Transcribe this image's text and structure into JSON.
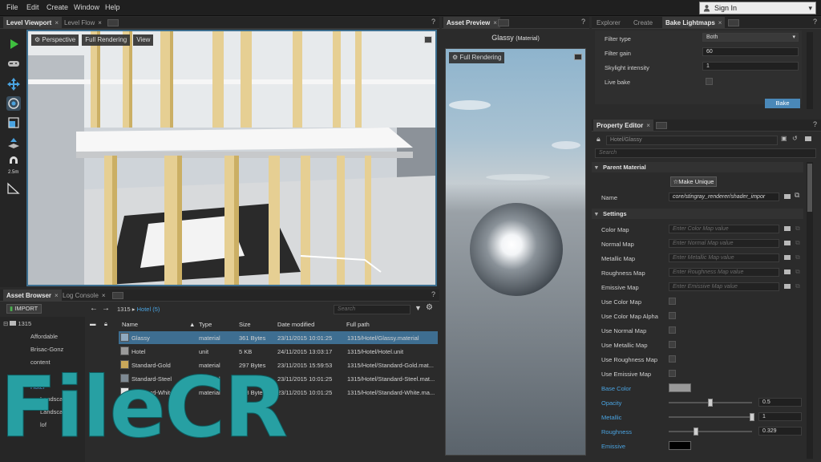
{
  "menu": [
    "File",
    "Edit",
    "Create",
    "Window",
    "Help"
  ],
  "signin": {
    "label": "Sign In"
  },
  "viewport_tabs": [
    "Level Viewport",
    "Level Flow"
  ],
  "viewport_toolbar": {
    "perspective": "Perspective",
    "rendering": "Full Rendering",
    "view": "View"
  },
  "tools": {
    "scale_label": "2.5m"
  },
  "asset_browser": {
    "tabs": [
      "Asset Browser",
      "Log Console"
    ],
    "import_label": "IMPORT",
    "breadcrumb_root": "1315",
    "breadcrumb_current": "Hotel (5)",
    "search_placeholder": "Search",
    "tree": [
      {
        "label": "1315"
      },
      {
        "label": "Affordable"
      },
      {
        "label": "Brisac-Gonz"
      },
      {
        "label": "content"
      },
      {
        "label": "Hotel"
      },
      {
        "label": "Landscape"
      },
      {
        "label": "Landscap"
      },
      {
        "label": "lof"
      }
    ],
    "columns": {
      "name": "Name",
      "type": "Type",
      "size": "Size",
      "date": "Date modified",
      "path": "Full path"
    },
    "rows": [
      {
        "name": "Glassy",
        "type": "material",
        "size": "361 Bytes",
        "date": "23/11/2015 10:01:25",
        "path": "1315/Hotel/Glassy.material"
      },
      {
        "name": "Hotel",
        "type": "unit",
        "size": "5 KB",
        "date": "24/11/2015 13:03:17",
        "path": "1315/Hotel/Hotel.unit"
      },
      {
        "name": "Standard-Gold",
        "type": "material",
        "size": "297 Bytes",
        "date": "23/11/2015 15:59:53",
        "path": "1315/Hotel/Standard-Gold.mat..."
      },
      {
        "name": "Standard-Steel",
        "type": "material",
        "size": "298 Bytes",
        "date": "23/11/2015 10:01:25",
        "path": "1315/Hotel/Standard-Steel.mat..."
      },
      {
        "name": "Standard-White",
        "type": "material",
        "size": "298 Bytes",
        "date": "23/11/2015 10:01:25",
        "path": "1315/Hotel/Standard-White.ma..."
      }
    ]
  },
  "asset_preview": {
    "tab": "Asset Preview",
    "title": "Glassy",
    "title_type": "(Material)",
    "rendering": "Full Rendering"
  },
  "right_tabs": [
    "Explorer",
    "Create",
    "Bake Lightmaps"
  ],
  "bake": {
    "filter_type_label": "Filter type",
    "filter_type_value": "Both",
    "filter_gain_label": "Filter gain",
    "filter_gain_value": "60",
    "skylight_label": "Skylight intensity",
    "skylight_value": "1",
    "live_bake_label": "Live bake",
    "bake_button": "Bake"
  },
  "property_editor": {
    "tab": "Property Editor",
    "path": "Hotel/Glassy",
    "search_placeholder": "Search",
    "parent_section": "Parent Material",
    "make_unique": "Make Unique",
    "name_label": "Name",
    "name_value": "core/stingray_renderer/shader_impor",
    "settings_section": "Settings",
    "maps": [
      {
        "label": "Color Map",
        "placeholder": "Enter Color Map value"
      },
      {
        "label": "Normal Map",
        "placeholder": "Enter Normal Map value"
      },
      {
        "label": "Metallic Map",
        "placeholder": "Enter Metallic Map value"
      },
      {
        "label": "Roughness Map",
        "placeholder": "Enter Roughness Map value"
      },
      {
        "label": "Emissive Map",
        "placeholder": "Enter Emissive Map value"
      }
    ],
    "toggles": [
      "Use Color Map",
      "Use Color Map Alpha",
      "Use Normal Map",
      "Use Metallic Map",
      "Use Roughness Map",
      "Use Emissive Map"
    ],
    "base_color_label": "Base Color",
    "base_color": "#9a9a9a",
    "opacity_label": "Opacity",
    "opacity_value": "0.5",
    "metallic_label": "Metallic",
    "metallic_value": "1",
    "roughness_label": "Roughness",
    "roughness_value": "0.329",
    "emissive_label": "Emissive",
    "emissive_color": "#000000"
  },
  "watermark": "FileCR",
  "colors": {
    "accent": "#3e6e91",
    "highlight_blue": "#4aa3e0",
    "bake_button": "#4a88b8"
  }
}
